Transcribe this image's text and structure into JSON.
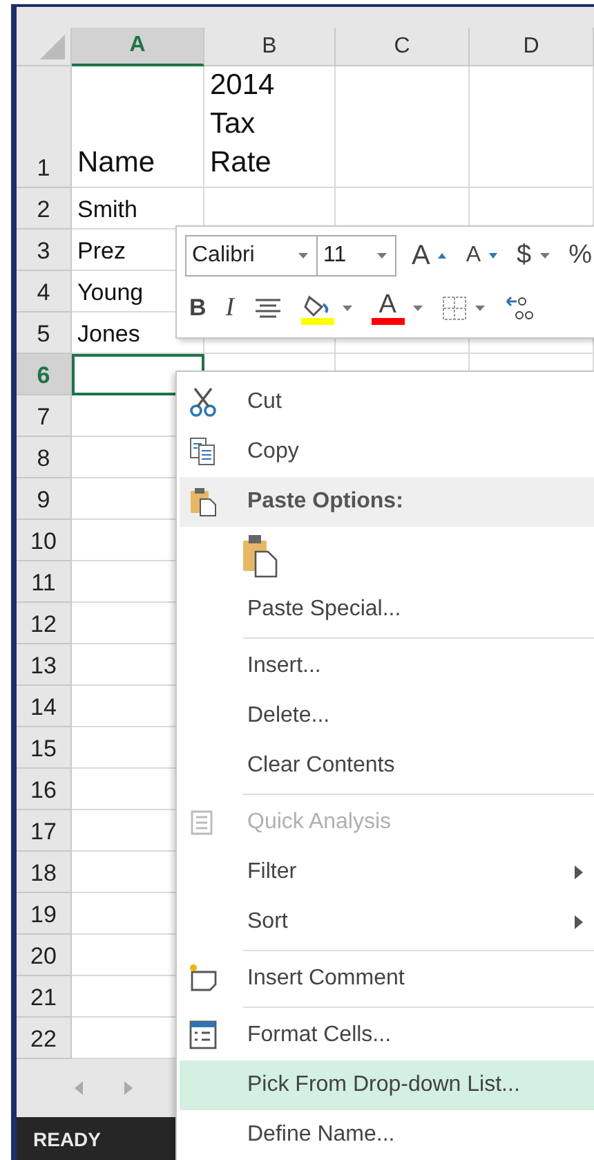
{
  "columns": [
    {
      "label": "A",
      "selected": true
    },
    {
      "label": "B",
      "selected": false
    },
    {
      "label": "C",
      "selected": false
    },
    {
      "label": "D",
      "selected": false
    }
  ],
  "rows": [
    {
      "label": "1",
      "selected": false,
      "cells": [
        "Name",
        "2014 Tax Rate"
      ]
    },
    {
      "label": "2",
      "selected": false,
      "cells": [
        "Smith"
      ]
    },
    {
      "label": "3",
      "selected": false,
      "cells": [
        "Prez"
      ]
    },
    {
      "label": "4",
      "selected": false,
      "cells": [
        "Young"
      ]
    },
    {
      "label": "5",
      "selected": false,
      "cells": [
        "Jones"
      ]
    },
    {
      "label": "6",
      "selected": true
    },
    {
      "label": "7",
      "selected": false
    },
    {
      "label": "8",
      "selected": false
    },
    {
      "label": "9",
      "selected": false
    },
    {
      "label": "10",
      "selected": false
    },
    {
      "label": "11",
      "selected": false
    },
    {
      "label": "12",
      "selected": false
    },
    {
      "label": "13",
      "selected": false
    },
    {
      "label": "14",
      "selected": false
    },
    {
      "label": "15",
      "selected": false
    },
    {
      "label": "16",
      "selected": false
    },
    {
      "label": "17",
      "selected": false
    },
    {
      "label": "18",
      "selected": false
    },
    {
      "label": "19",
      "selected": false
    },
    {
      "label": "20",
      "selected": false
    },
    {
      "label": "21",
      "selected": false
    },
    {
      "label": "22",
      "selected": false
    }
  ],
  "mini_toolbar": {
    "font": "Calibri",
    "size": "11",
    "row_1": [
      {
        "kind": "grow",
        "label": "A"
      },
      {
        "kind": "shrink",
        "label": "A"
      },
      {
        "kind": "dropdown-text",
        "label": "$"
      },
      {
        "kind": "text",
        "label": "%"
      }
    ],
    "row_2": [
      {
        "kind": "bold",
        "label": "B"
      },
      {
        "kind": "italic",
        "label": "I"
      },
      {
        "kind": "align"
      },
      {
        "kind": "fill",
        "color": "#ffff00"
      },
      {
        "kind": "font-color",
        "label": "A",
        "color": "#ff0000"
      },
      {
        "kind": "borders"
      },
      {
        "kind": "decimal"
      }
    ]
  },
  "context_menu": [
    {
      "kind": "item",
      "label": "Cut",
      "disabled": false,
      "submenu": false,
      "selected": false
    },
    {
      "kind": "item",
      "label": "Copy",
      "disabled": false,
      "submenu": false,
      "selected": false
    },
    {
      "kind": "header",
      "label": "Paste Options:"
    },
    {
      "kind": "paste-buttons"
    },
    {
      "kind": "item",
      "label": "Paste Special...",
      "disabled": false,
      "submenu": false,
      "selected": false
    },
    {
      "kind": "separator"
    },
    {
      "kind": "item",
      "label": "Insert...",
      "disabled": false,
      "submenu": false,
      "selected": false
    },
    {
      "kind": "item",
      "label": "Delete...",
      "disabled": false,
      "submenu": false,
      "selected": false
    },
    {
      "kind": "item",
      "label": "Clear Contents",
      "disabled": false,
      "submenu": false,
      "selected": false
    },
    {
      "kind": "separator"
    },
    {
      "kind": "item",
      "label": "Quick Analysis",
      "disabled": true,
      "submenu": false,
      "selected": false
    },
    {
      "kind": "item",
      "label": "Filter",
      "disabled": false,
      "submenu": true,
      "selected": false
    },
    {
      "kind": "item",
      "label": "Sort",
      "disabled": false,
      "submenu": true,
      "selected": false
    },
    {
      "kind": "separator"
    },
    {
      "kind": "item",
      "label": "Insert Comment",
      "disabled": false,
      "submenu": false,
      "selected": false
    },
    {
      "kind": "separator"
    },
    {
      "kind": "item",
      "label": "Format Cells...",
      "disabled": false,
      "submenu": false,
      "selected": false
    },
    {
      "kind": "item",
      "label": "Pick From Drop-down List...",
      "disabled": false,
      "submenu": false,
      "selected": true
    },
    {
      "kind": "item",
      "label": "Define Name...",
      "disabled": false,
      "submenu": false,
      "selected": false
    }
  ],
  "status_bar": {
    "mode": "READY"
  }
}
